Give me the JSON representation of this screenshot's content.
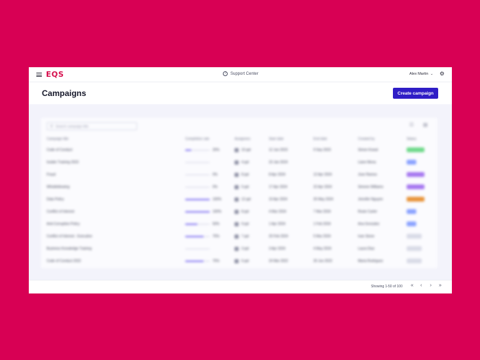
{
  "topbar": {
    "logo": "EQS",
    "support_label": "Support Center",
    "user_name": "Alex Martin"
  },
  "header": {
    "title": "Campaigns",
    "create_button": "Create campaign"
  },
  "table": {
    "search_placeholder": "Search campaign title",
    "columns": [
      "Campaign title",
      "Completion rate",
      "Assignees",
      "Start date",
      "End date",
      "Created by",
      "Status"
    ],
    "rows": [
      {
        "title": "Code of Conduct",
        "progress": 0.25,
        "pct": "25%",
        "assignees": "10 ppl",
        "start": "12 Jun 2023",
        "end": "9 Sep 2023",
        "creator": "Simon Kowal",
        "status": "Active",
        "status_color": "#6fd98a"
      },
      {
        "title": "Insider Training 2023",
        "progress": 0.0,
        "pct": "",
        "assignees": "4 ppl",
        "start": "23 Jan 2024",
        "end": "",
        "creator": "Liane Mona",
        "status": "Draft",
        "status_color": "#8aa2ff"
      },
      {
        "title": "Fraud",
        "progress": 0.0,
        "pct": "0%",
        "assignees": "8 ppl",
        "start": "8 Apr 2024",
        "end": "12 Apr 2024",
        "creator": "Jose Ramos",
        "status": "Scheduled",
        "status_color": "#a678f0"
      },
      {
        "title": "Whistleblowing",
        "progress": 0.0,
        "pct": "0%",
        "assignees": "5 ppl",
        "start": "17 Apr 2024",
        "end": "22 Apr 2024",
        "creator": "Simone Williams",
        "status": "Scheduled",
        "status_color": "#a678f0"
      },
      {
        "title": "Data Policy",
        "progress": 1.0,
        "pct": "100%",
        "assignees": "12 ppl",
        "start": "10 Apr 2024",
        "end": "26 May 2024",
        "creator": "Jennifer Nguyen",
        "status": "Overdue",
        "status_color": "#e8943a"
      },
      {
        "title": "Conflict of Interest",
        "progress": 1.0,
        "pct": "100%",
        "assignees": "8 ppl",
        "start": "4 Mar 2024",
        "end": "7 Mar 2024",
        "creator": "Rosie Carter",
        "status": "Done",
        "status_color": "#8aa2ff"
      },
      {
        "title": "Anti-Corruption Policy",
        "progress": 0.5,
        "pct": "50%",
        "assignees": "9 ppl",
        "start": "1 Apr 2024",
        "end": "1 Feb 2024",
        "creator": "Ana Gonzalez",
        "status": "Done",
        "status_color": "#8aa2ff"
      },
      {
        "title": "Conflict of Interest - Executive",
        "progress": 0.75,
        "pct": "75%",
        "assignees": "7 ppl",
        "start": "20 Feb 2024",
        "end": "5 Mar 2024",
        "creator": "Ivan Stone",
        "status": "Ended",
        "status_color": "#d9dbe7"
      },
      {
        "title": "Business Knowledge Training",
        "progress": 0.0,
        "pct": "",
        "assignees": "3 ppl",
        "start": "3 Apr 2024",
        "end": "4 May 2024",
        "creator": "Laura Diaz",
        "status": "Ended",
        "status_color": "#d9dbe7"
      },
      {
        "title": "Code of Conduct 2022",
        "progress": 0.75,
        "pct": "75%",
        "assignees": "6 ppl",
        "start": "24 Mar 2022",
        "end": "26 Jun 2022",
        "creator": "Maria Rodriguez",
        "status": "Ended",
        "status_color": "#d9dbe7"
      }
    ]
  },
  "footer": {
    "showing": "Showing 1-50 of 100"
  },
  "colors": {
    "background": "#d80054",
    "brand": "#d6104e",
    "primary_button": "#2f1dc6"
  }
}
